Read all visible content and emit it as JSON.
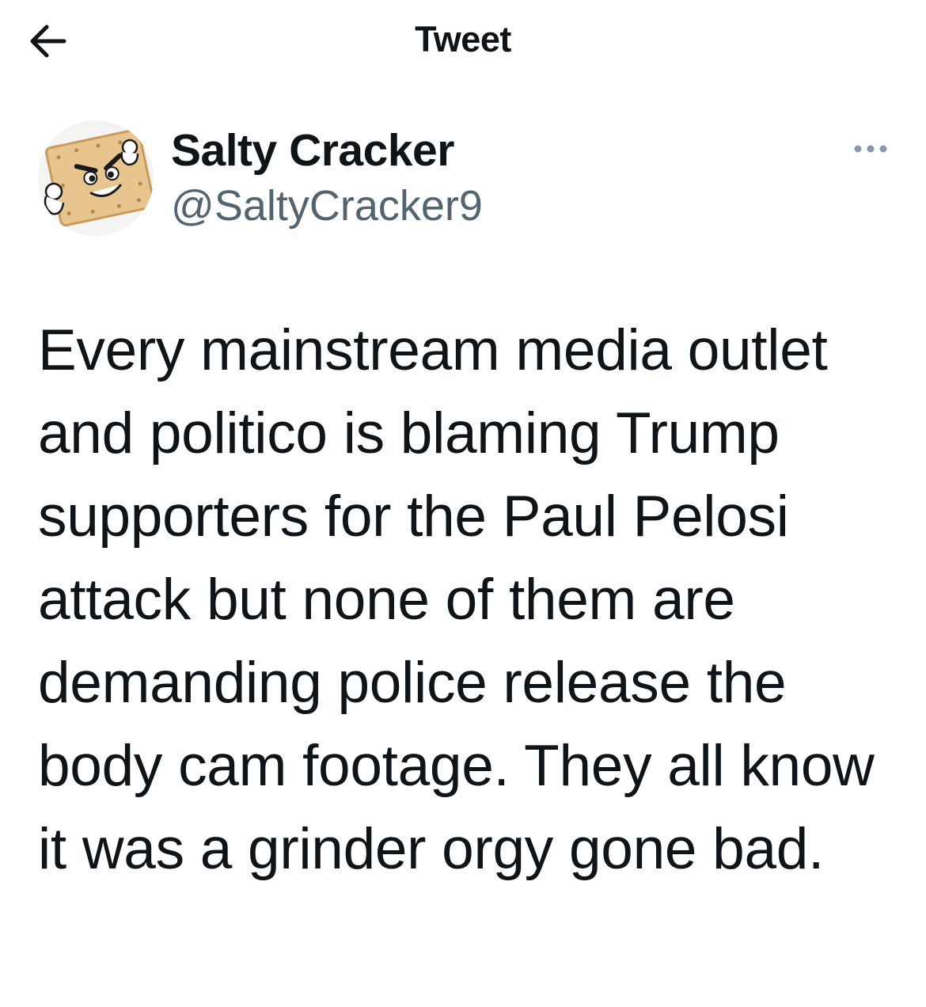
{
  "header": {
    "title": "Tweet",
    "back_icon": "arrow-left-icon"
  },
  "tweet": {
    "author": {
      "display_name": "Salty Cracker",
      "handle": "@SaltyCracker9",
      "avatar_icon": "cracker-cartoon-avatar"
    },
    "more_icon": "more-horizontal-icon",
    "text": "Every mainstream media outlet and politico is blaming Trump supporters for the Paul Pelosi attack but none of them are demanding police release the body cam footage. They all know it was a grinder orgy gone bad."
  },
  "colors": {
    "text_primary": "#0f1419",
    "text_secondary": "#536471",
    "background": "#ffffff",
    "cracker": "#e8c48f"
  }
}
